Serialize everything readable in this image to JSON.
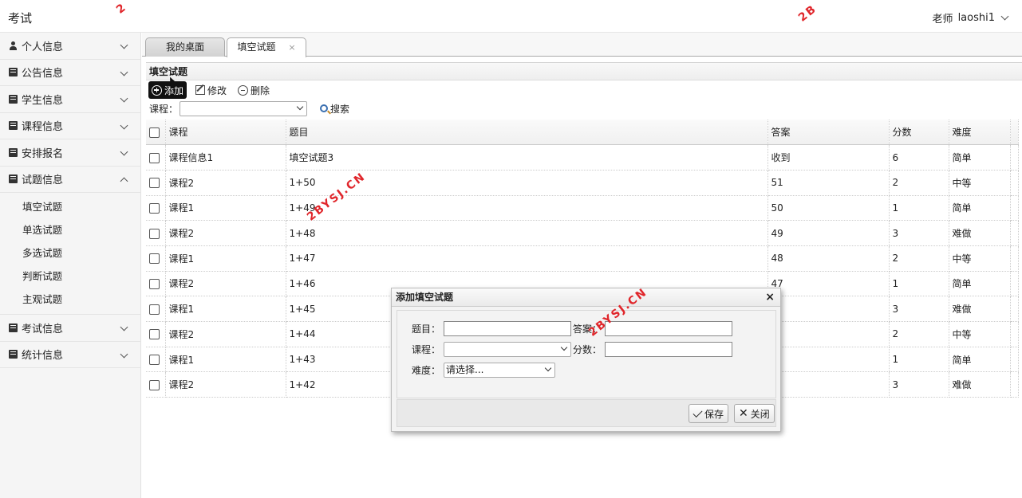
{
  "header": {
    "app_title": "考试",
    "user_role": "老师",
    "username": "laoshi1"
  },
  "sidebar": {
    "items": [
      {
        "label": "个人信息",
        "icon": "user-icon",
        "expanded": false
      },
      {
        "label": "公告信息",
        "icon": "book-icon",
        "expanded": false
      },
      {
        "label": "学生信息",
        "icon": "book-icon",
        "expanded": false
      },
      {
        "label": "课程信息",
        "icon": "book-icon",
        "expanded": false
      },
      {
        "label": "安排报名",
        "icon": "book-icon",
        "expanded": false
      },
      {
        "label": "试题信息",
        "icon": "book-icon",
        "expanded": true
      },
      {
        "label": "考试信息",
        "icon": "book-icon",
        "expanded": false
      },
      {
        "label": "统计信息",
        "icon": "book-icon",
        "expanded": false
      }
    ],
    "submenu": [
      "填空试题",
      "单选试题",
      "多选试题",
      "判断试题",
      "主观试题"
    ]
  },
  "tabs": [
    {
      "label": "我的桌面"
    },
    {
      "label": "填空试题",
      "close": "×"
    }
  ],
  "panel": {
    "title": "填空试题",
    "toolbar": {
      "add": "添加",
      "edit": "修改",
      "delete": "删除"
    },
    "filter": {
      "course_label": "课程：",
      "search": "搜索"
    }
  },
  "table": {
    "headers": [
      "课程",
      "题目",
      "答案",
      "分数",
      "难度"
    ],
    "rows": [
      [
        "课程信息1",
        "填空试题3",
        "收到",
        "6",
        "简单"
      ],
      [
        "课程2",
        "1+50",
        "51",
        "2",
        "中等"
      ],
      [
        "课程1",
        "1+49",
        "50",
        "1",
        "简单"
      ],
      [
        "课程2",
        "1+48",
        "49",
        "3",
        "难做"
      ],
      [
        "课程1",
        "1+47",
        "48",
        "2",
        "中等"
      ],
      [
        "课程2",
        "1+46",
        "47",
        "1",
        "简单"
      ],
      [
        "课程1",
        "1+45",
        "",
        "3",
        "难做"
      ],
      [
        "课程2",
        "1+44",
        "",
        "2",
        "中等"
      ],
      [
        "课程1",
        "1+43",
        "",
        "1",
        "简单"
      ],
      [
        "课程2",
        "1+42",
        "",
        "3",
        "难做"
      ]
    ]
  },
  "dialog": {
    "title": "添加填空试题",
    "close": "×",
    "fields": {
      "question_label": "题目：",
      "answer_label": "答案：",
      "course_label": "课程：",
      "score_label": "分数：",
      "difficulty_label": "难度：",
      "difficulty_value": "请选择..."
    },
    "save": "保存",
    "cancel": "关闭"
  },
  "watermarks": [
    "2BYSJ.CN",
    "2BYSJ.CN",
    "2B",
    "2"
  ],
  "colors": {
    "watermark": "#e0262b",
    "active_button": "#111111"
  }
}
